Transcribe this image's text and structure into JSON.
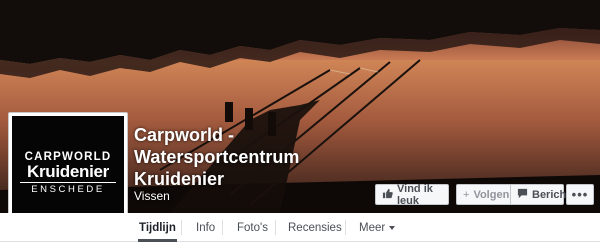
{
  "page": {
    "name": "Carpworld - Watersportcentrum Kruidenier",
    "category": "Vissen"
  },
  "logo": {
    "top": "CARPWORLD",
    "middle": "Kruidenier",
    "bottom": "ENSCHEDE"
  },
  "actions": {
    "like_label": "Vind ik leuk",
    "follow_label": "Volgen",
    "message_label": "Bericht",
    "more_label": "•••"
  },
  "icons": {
    "like": "thumbs-up-icon",
    "follow": "plus-icon",
    "message": "chat-bubble-icon",
    "more": "ellipsis-icon",
    "dropdown": "caret-down-icon"
  },
  "tabs": [
    {
      "label": "Tijdlijn",
      "active": true
    },
    {
      "label": "Info"
    },
    {
      "label": "Foto's"
    },
    {
      "label": "Recensies"
    },
    {
      "label": "Meer"
    }
  ],
  "colors": {
    "button_bg": "#f6f7f9",
    "button_text": "#4b4f56",
    "muted_text": "#90949c"
  }
}
